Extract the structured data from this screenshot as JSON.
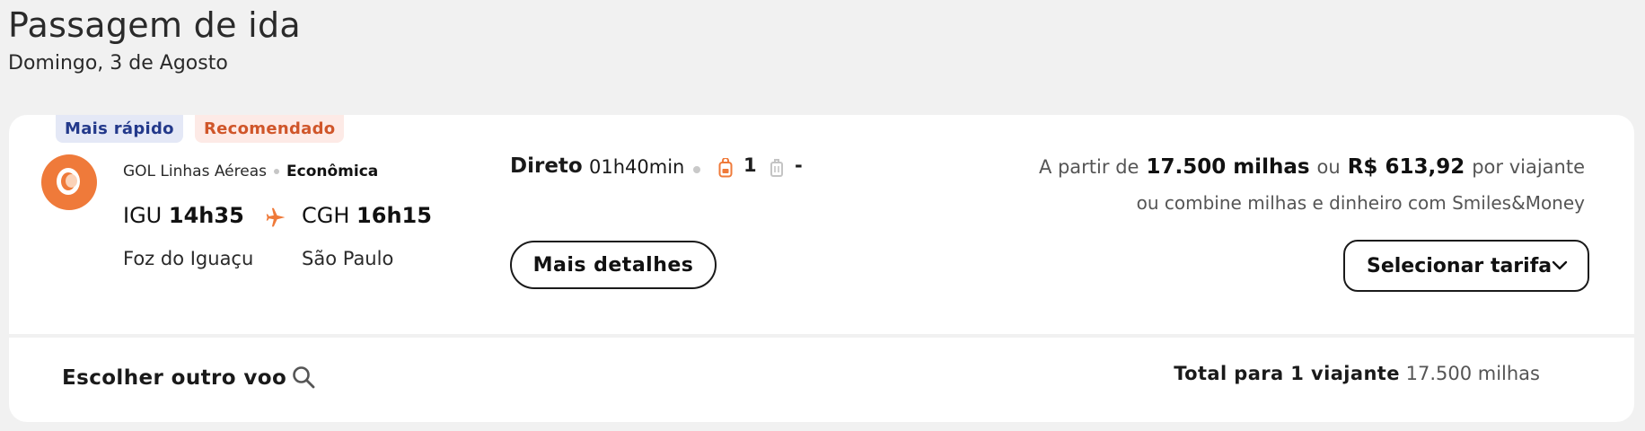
{
  "header": {
    "title": "Passagem de ida",
    "date": "Domingo, 3 de Agosto"
  },
  "flight": {
    "tags": {
      "fastest": "Mais rápido",
      "recommended": "Recomendado"
    },
    "airline": "GOL Linhas Aéreas",
    "cabin": "Econômica",
    "origin": {
      "code": "IGU",
      "time": "14h35",
      "city": "Foz do Iguaçu"
    },
    "destination": {
      "code": "CGH",
      "time": "16h15",
      "city": "São Paulo"
    },
    "stops": "Direto",
    "duration": "01h40min",
    "carry_on_count": "1",
    "checked_bag": "-",
    "details_label": "Mais detalhes",
    "price": {
      "prefix": "A partir de",
      "miles": "17.500 milhas",
      "or": "ou",
      "cash": "R$ 613,92",
      "suffix": "por viajante",
      "combine_text": "ou combine milhas e dinheiro com Smiles&Money"
    },
    "select_label": "Selecionar tarifa"
  },
  "footer": {
    "other_flight_label": "Escolher outro voo",
    "total_label": "Total para 1 viajante",
    "total_value": "17.500 milhas"
  },
  "icons": {
    "airline_logo": "gol-logo-icon",
    "plane": "plane-icon",
    "carry_on": "backpack-icon",
    "checked_bag": "luggage-icon",
    "chevron": "chevron-down-icon",
    "search": "search-icon"
  },
  "colors": {
    "accent": "#ef7a3a",
    "fast_tag_bg": "#e4e8f6",
    "fast_tag_text": "#23398b",
    "rec_tag_bg": "#fdeae6",
    "rec_tag_text": "#d0562a"
  }
}
